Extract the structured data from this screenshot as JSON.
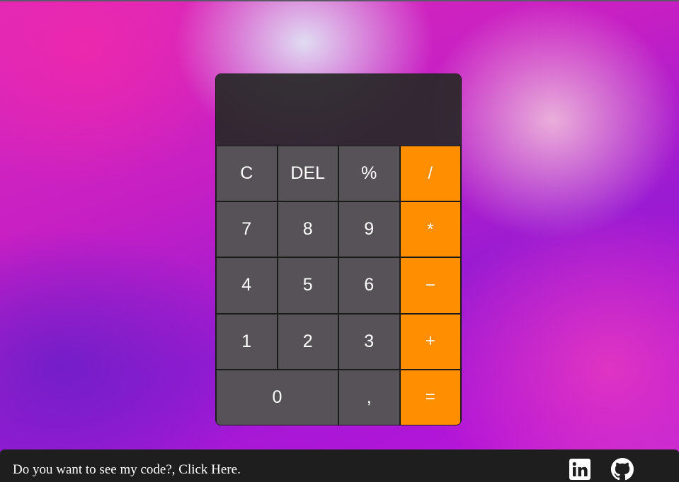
{
  "calculator": {
    "display_value": "",
    "keys": [
      "C",
      "DEL",
      "%",
      "/",
      "7",
      "8",
      "9",
      "*",
      "4",
      "5",
      "6",
      "−",
      "1",
      "2",
      "3",
      "+",
      "0",
      ",",
      "="
    ],
    "colors": {
      "number_key": "#5f5a5f",
      "operator_key": "#ff8e00",
      "display_bg": "#282828"
    }
  },
  "footer": {
    "text": "Do you want to see my code?, Click Here.",
    "icons": [
      "linkedin-icon",
      "github-icon"
    ]
  }
}
